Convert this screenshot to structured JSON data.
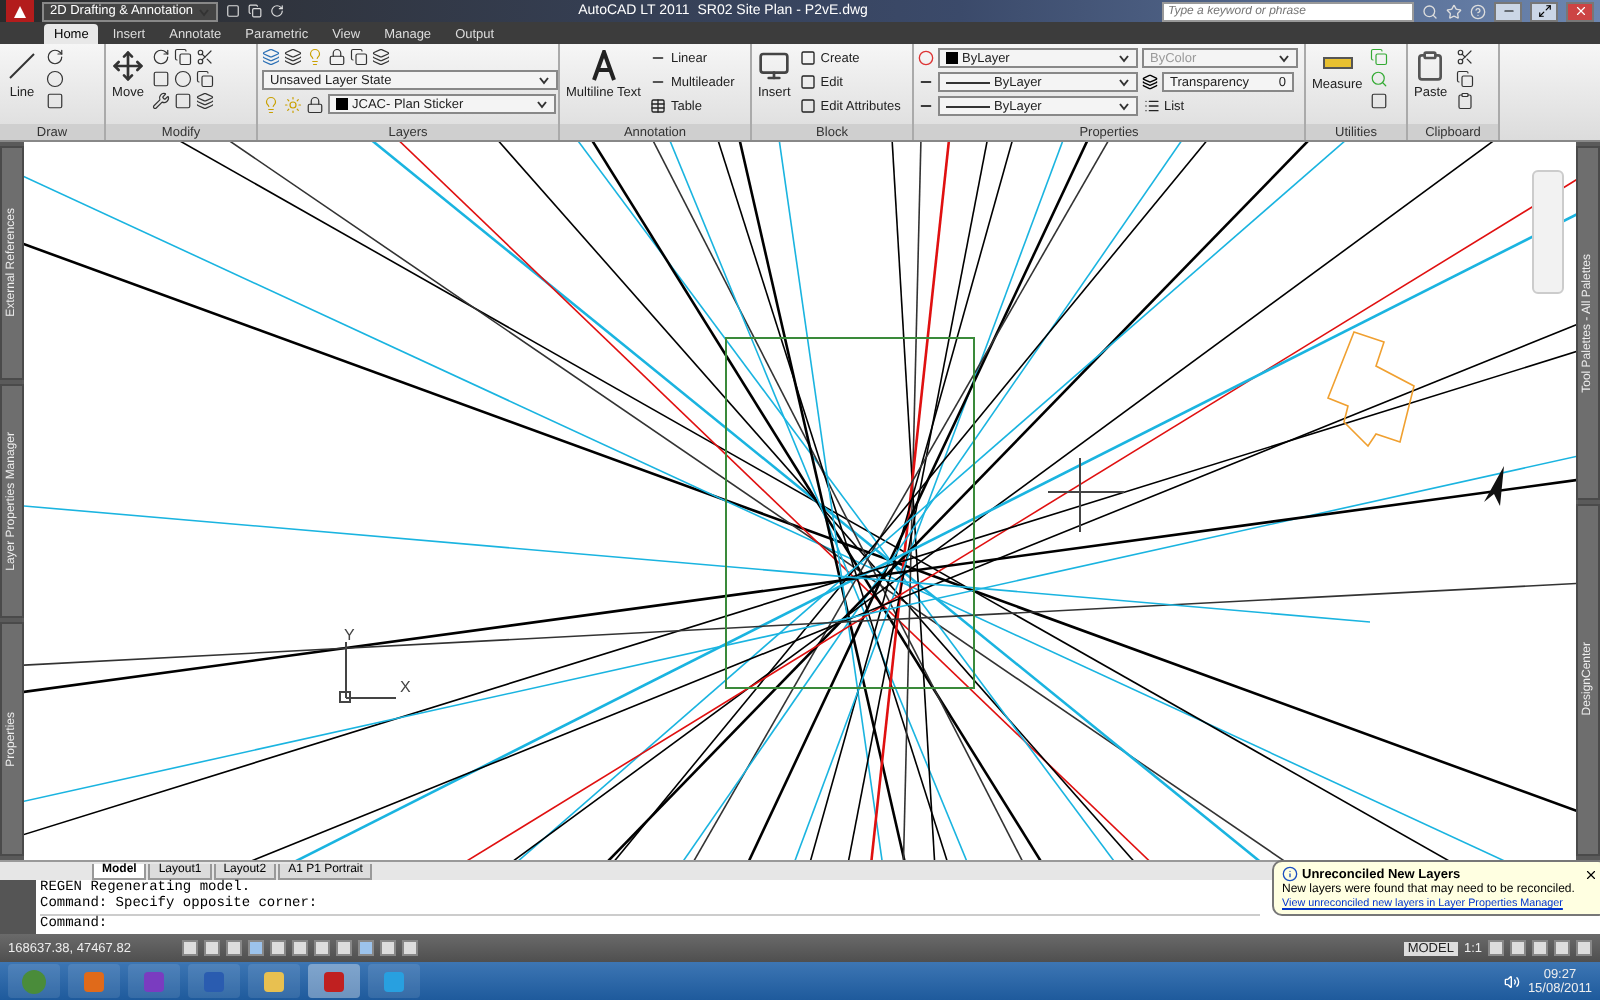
{
  "title_bar": {
    "workspace": "2D Drafting & Annotation",
    "app": "AutoCAD LT 2011",
    "document": "SR02 Site Plan - P2vE.dwg",
    "search_placeholder": "Type a keyword or phrase"
  },
  "ribbon_tabs": [
    {
      "label": "Home",
      "selected": true
    },
    {
      "label": "Insert",
      "selected": false
    },
    {
      "label": "Annotate",
      "selected": false
    },
    {
      "label": "Parametric",
      "selected": false
    },
    {
      "label": "View",
      "selected": false
    },
    {
      "label": "Manage",
      "selected": false
    },
    {
      "label": "Output",
      "selected": false
    }
  ],
  "ribbon_panels": [
    {
      "kind": "draw",
      "title": "Draw",
      "big_button": "Line"
    },
    {
      "kind": "modify",
      "title": "Modify",
      "big_button": "Move"
    },
    {
      "kind": "layers",
      "title": "Layers",
      "layer_state": "Unsaved Layer State",
      "current_layer": "JCAC- Plan Sticker"
    },
    {
      "kind": "annotation",
      "title": "Annotation",
      "big_button": "Multiline Text",
      "items": [
        "Linear",
        "Multileader",
        "Table"
      ]
    },
    {
      "kind": "block",
      "title": "Block",
      "big_button": "Insert",
      "items": [
        "Create",
        "Edit",
        "Edit Attributes"
      ]
    },
    {
      "kind": "properties",
      "title": "Properties",
      "object_color": "ByLayer",
      "lineweight": "ByLayer",
      "linetype": "ByLayer",
      "plot_style": "ByColor",
      "transparency_label": "Transparency",
      "transparency_value": "0",
      "list": "List"
    },
    {
      "kind": "utilities",
      "title": "Utilities",
      "big_button": "Measure"
    },
    {
      "kind": "clipboard",
      "title": "Clipboard",
      "big_button": "Paste"
    }
  ],
  "left_palettes": [
    "External References",
    "Layer Properties Manager",
    "Properties"
  ],
  "right_palettes": [
    "Tool Palettes - All Palettes",
    "DesignCenter"
  ],
  "ucs": {
    "y": "Y",
    "x": "X"
  },
  "layout_tabs": [
    {
      "label": "Model",
      "selected": true
    },
    {
      "label": "Layout1",
      "selected": false
    },
    {
      "label": "Layout2",
      "selected": false
    },
    {
      "label": "A1 P1 Portrait",
      "selected": false
    }
  ],
  "command_history": [
    "REGEN Regenerating model.",
    "Command: Specify opposite corner:"
  ],
  "command_prompt": "Command:",
  "status_bar": {
    "coordinates": "168637.38, 47467.82",
    "space": "MODEL",
    "scale": "1:1"
  },
  "notification": {
    "title": "Unreconciled New Layers",
    "message": "New layers were found that may need to be reconciled.",
    "link": "View unreconciled new layers in Layer Properties Manager"
  },
  "taskbar": {
    "time": "09:27",
    "date": "15/08/2011"
  }
}
